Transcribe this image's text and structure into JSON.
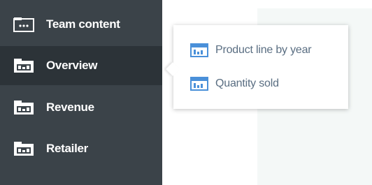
{
  "colors": {
    "sidebar_bg": "#3b4349",
    "sidebar_active_bg": "#2c3338",
    "sidebar_text": "#ffffff",
    "flyout_bg": "#ffffff",
    "flyout_text": "#5a6e82",
    "flyout_icon_accent": "#4a90d9",
    "content_pane_bg": "#f4f8f7"
  },
  "sidebar": {
    "items": [
      {
        "label": "Team content",
        "icon": "team-folder-icon",
        "active": false
      },
      {
        "label": "Overview",
        "icon": "folder-icon",
        "active": true
      },
      {
        "label": "Revenue",
        "icon": "folder-icon",
        "active": false
      },
      {
        "label": "Retailer",
        "icon": "folder-icon",
        "active": false
      }
    ]
  },
  "flyout": {
    "items": [
      {
        "label": "Product line by year",
        "icon": "report-icon"
      },
      {
        "label": "Quantity sold",
        "icon": "report-icon"
      }
    ]
  }
}
